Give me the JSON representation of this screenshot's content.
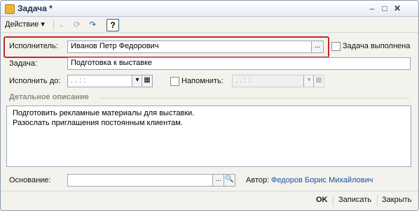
{
  "window": {
    "title": "Задача *"
  },
  "toolbar": {
    "action_label": "Действие"
  },
  "form": {
    "executor_label": "Исполнитель:",
    "executor_value": "Иванов Петр Федорович",
    "done_label": "Задача выполнена",
    "task_label": "Задача:",
    "task_value": "Подготовка к выставке",
    "due_label": "Исполнить до:",
    "due_value": ". .      : :",
    "remind_label": "Напомнить:",
    "remind_value": ". .      : :",
    "details_section": "Детальное описание",
    "details_lines": [
      "Подготовить рекламные материалы для выставки.",
      "Разослать приглашения постоянным клиентам."
    ],
    "basis_label": "Основание:",
    "author_label": "Автор:",
    "author_value": "Федоров Борис Михайлович"
  },
  "footer": {
    "ok": "OK",
    "save": "Записать",
    "close": "Закрыть"
  },
  "icons": {
    "ellipsis": "...",
    "search": "🔍",
    "dropdown": "▾",
    "help": "?"
  }
}
